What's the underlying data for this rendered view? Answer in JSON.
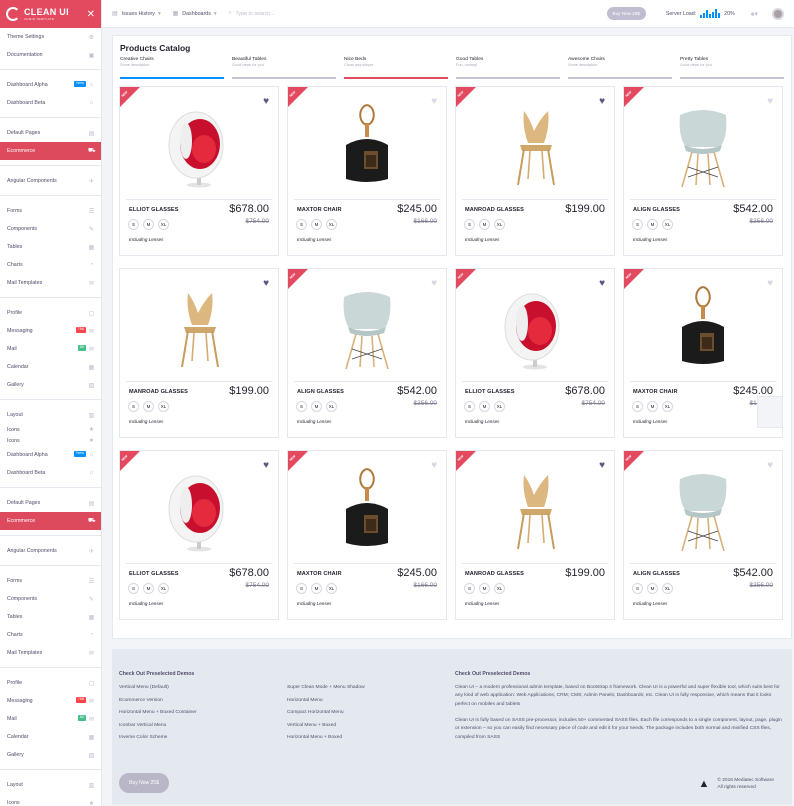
{
  "brand": {
    "title": "CLEAN UI",
    "subtitle": "ADMIN TEMPLATE",
    "close_icon": "close-icon"
  },
  "sidebar": {
    "items": [
      {
        "label": "Theme Settings",
        "icon": "gear-icon",
        "glyph": "⚙"
      },
      {
        "label": "Documentation",
        "icon": "book-icon",
        "glyph": "▣"
      },
      {
        "sep": true
      },
      {
        "label": "Dashboard Alpha",
        "icon": "home-icon",
        "glyph": "⌂",
        "badge": "New",
        "badge_color": "blue"
      },
      {
        "label": "Dashboard Beta",
        "icon": "home-icon",
        "glyph": "⌂"
      },
      {
        "sep": true
      },
      {
        "label": "Default Pages",
        "icon": "page-icon",
        "glyph": "▤"
      },
      {
        "label": "Ecommerce",
        "icon": "cart-icon",
        "glyph": "⛟",
        "active": true
      },
      {
        "sep": true
      },
      {
        "label": "Angular Components",
        "icon": "rocket-icon",
        "glyph": "✈"
      },
      {
        "sep": true
      },
      {
        "label": "Forms",
        "icon": "list-icon",
        "glyph": "☰"
      },
      {
        "label": "Components",
        "icon": "tag-icon",
        "glyph": "✎"
      },
      {
        "label": "Tables",
        "icon": "table-icon",
        "glyph": "▦"
      },
      {
        "label": "Charts",
        "icon": "chart-icon",
        "glyph": "◔"
      },
      {
        "label": "Mail Templates",
        "icon": "mail-icon",
        "glyph": "✉"
      },
      {
        "sep": true
      },
      {
        "label": "Profile",
        "icon": "profile-icon",
        "glyph": "▢"
      },
      {
        "label": "Messaging",
        "icon": "message-icon",
        "glyph": "✉",
        "badge": "768",
        "badge_color": "red"
      },
      {
        "label": "Mail",
        "icon": "mail-icon",
        "glyph": "✉",
        "badge": "84",
        "badge_color": "green"
      },
      {
        "label": "Calendar",
        "icon": "calendar-icon",
        "glyph": "▦"
      },
      {
        "label": "Gallery",
        "icon": "gallery-icon",
        "glyph": "▨"
      },
      {
        "sep": true
      },
      {
        "label": "Layout",
        "icon": "layout-icon",
        "glyph": "▥"
      },
      {
        "label": "Icons",
        "icon": "star-icon",
        "glyph": "★",
        "compact": true
      },
      {
        "label": "Icons",
        "icon": "star-icon",
        "glyph": "★",
        "compact": true
      },
      {
        "label": "Dashboard Alpha",
        "icon": "home-icon",
        "glyph": "⌂",
        "badge": "New",
        "badge_color": "blue"
      },
      {
        "label": "Dashboard Beta",
        "icon": "home-icon",
        "glyph": "⌂"
      },
      {
        "sep": true
      },
      {
        "label": "Default Pages",
        "icon": "page-icon",
        "glyph": "▤"
      },
      {
        "label": "Ecommerce",
        "icon": "cart-icon",
        "glyph": "⛟",
        "active": true
      },
      {
        "sep": true
      },
      {
        "label": "Angular Components",
        "icon": "rocket-icon",
        "glyph": "✈"
      },
      {
        "sep": true
      },
      {
        "label": "Forms",
        "icon": "list-icon",
        "glyph": "☰"
      },
      {
        "label": "Components",
        "icon": "tag-icon",
        "glyph": "✎"
      },
      {
        "label": "Tables",
        "icon": "table-icon",
        "glyph": "▦"
      },
      {
        "label": "Charts",
        "icon": "chart-icon",
        "glyph": "◔"
      },
      {
        "label": "Mail Templates",
        "icon": "mail-icon",
        "glyph": "✉"
      },
      {
        "sep": true
      },
      {
        "label": "Profile",
        "icon": "profile-icon",
        "glyph": "▢"
      },
      {
        "label": "Messaging",
        "icon": "message-icon",
        "glyph": "✉",
        "badge": "768",
        "badge_color": "red"
      },
      {
        "label": "Mail",
        "icon": "mail-icon",
        "glyph": "✉",
        "badge": "84",
        "badge_color": "green"
      },
      {
        "label": "Calendar",
        "icon": "calendar-icon",
        "glyph": "▦"
      },
      {
        "label": "Gallery",
        "icon": "gallery-icon",
        "glyph": "▨"
      },
      {
        "sep": true
      },
      {
        "label": "Layout",
        "icon": "layout-icon",
        "glyph": "▥"
      },
      {
        "label": "Icons",
        "icon": "star-icon",
        "glyph": "★"
      }
    ]
  },
  "topbar": {
    "issues": "Issues History",
    "dashboards": "Dashboards",
    "search_placeholder": "Type to search...",
    "buy_button": "Buy Now 25$",
    "server_label": "Server Load:",
    "server_value": "20%"
  },
  "catalog": {
    "title": "Products Catalog",
    "tabs": [
      {
        "title": "Creative Chairs",
        "sub": "Some description",
        "color": "blue"
      },
      {
        "title": "Beautiful Tables",
        "sub": "Good news for you",
        "color": "grey"
      },
      {
        "title": "Nice Beds",
        "sub": "Clean and simple",
        "color": "red"
      },
      {
        "title": "Good Tables",
        "sub": "Fun, hooray!",
        "color": "grey"
      },
      {
        "title": "Awesome Chairs",
        "sub": "Some description",
        "color": "grey"
      },
      {
        "title": "Pretty Tables",
        "sub": "Good news for you",
        "color": "grey"
      }
    ],
    "ribbon_label": "NEW",
    "products": [
      {
        "name": "ELLIOT GLASSES",
        "price": "$678.00",
        "old": "$754.00",
        "img": "egg",
        "liked": true,
        "note": "Including Lenses",
        "sizes": [
          "S",
          "M",
          "XL"
        ]
      },
      {
        "name": "MAXTOR CHAIR",
        "price": "$245.00",
        "old": "$166.00",
        "img": "dust",
        "liked": false,
        "note": "Including Lenses",
        "sizes": [
          "S",
          "M",
          "XL"
        ]
      },
      {
        "name": "MANROAD GLASSES",
        "price": "$199.00",
        "old": "",
        "img": "wood",
        "liked": true,
        "note": "Including Lenses",
        "sizes": [
          "S",
          "M",
          "XL"
        ]
      },
      {
        "name": "ALIGN GLASSES",
        "price": "$542.00",
        "old": "$356.00",
        "img": "eames",
        "liked": false,
        "note": "Including Lenses",
        "sizes": [
          "S",
          "M",
          "XL"
        ]
      },
      {
        "name": "MANROAD GLASSES",
        "price": "$199.00",
        "old": "",
        "img": "wood",
        "liked": true,
        "note": "Including Lenses",
        "sizes": [
          "S",
          "M",
          "XL"
        ],
        "noribbon": true
      },
      {
        "name": "ALIGN GLASSES",
        "price": "$542.00",
        "old": "$356.00",
        "img": "eames",
        "liked": false,
        "note": "Including Lenses",
        "sizes": [
          "S",
          "M",
          "XL"
        ]
      },
      {
        "name": "ELLIOT GLASSES",
        "price": "$678.00",
        "old": "$754.00",
        "img": "egg",
        "liked": true,
        "note": "Including Lenses",
        "sizes": [
          "S",
          "M",
          "XL"
        ]
      },
      {
        "name": "MAXTOR CHAIR",
        "price": "$245.00",
        "old": "$166.00",
        "img": "dust",
        "liked": false,
        "note": "Including Lenses",
        "sizes": [
          "S",
          "M",
          "XL"
        ]
      },
      {
        "name": "ELLIOT GLASSES",
        "price": "$678.00",
        "old": "$754.00",
        "img": "egg",
        "liked": true,
        "note": "Including Lenses",
        "sizes": [
          "S",
          "M",
          "XL"
        ]
      },
      {
        "name": "MAXTOR CHAIR",
        "price": "$245.00",
        "old": "$166.00",
        "img": "dust",
        "liked": false,
        "note": "Including Lenses",
        "sizes": [
          "S",
          "M",
          "XL"
        ]
      },
      {
        "name": "MANROAD GLASSES",
        "price": "$199.00",
        "old": "",
        "img": "wood",
        "liked": true,
        "note": "Including Lenses",
        "sizes": [
          "S",
          "M",
          "XL"
        ]
      },
      {
        "name": "ALIGN GLASSES",
        "price": "$542.00",
        "old": "$356.00",
        "img": "eames",
        "liked": false,
        "note": "Including Lenses",
        "sizes": [
          "S",
          "M",
          "XL"
        ]
      }
    ]
  },
  "footer": {
    "heading_left": "Check Out Preselected Demos",
    "heading_right": "Check Out Preselected Demos",
    "col1": [
      "Vertical Menu (Default)",
      "Ecommerce Version",
      "Horizontal Menu + Boxed Container",
      "Iconbar Vertical Menu",
      "Inverse Color Scheme"
    ],
    "col2": [
      "Super Clean Mode + Menu Shadow",
      "Horizontal Menu",
      "Compact Horizontal Menu",
      "Vertical Menu + Boxed",
      "Horizontal Menu + Boxed"
    ],
    "para1": "Clean UI – a modern professional admin template, based on Bootstrap 4 framework. Clean UI is a powerful and super flexible tool, which suits best for any kind of web application: Web Applications; CRM; CMS; Admin Panels; Dashboards; etc. Clean UI is fully responsive, which means that it looks perfect on mobiles and tablets",
    "para2": "Clean UI is fully based on SASS pre-processor, includes 50+ commented SASS files. Each file corresponds to a single component, layout, page, plugin or extension – so you can easily find necessary piece of code and edit it for your needs. The package includes both normal and minified CSS files, compiled from SASS",
    "buy": "Buy Now 25$",
    "copyright1": "© 2016 Mediatec Software",
    "copyright2": "All rights reserved"
  },
  "colors": {
    "accent": "#e34a5f",
    "blue": "#0190fe",
    "heart": "#5b5581"
  }
}
